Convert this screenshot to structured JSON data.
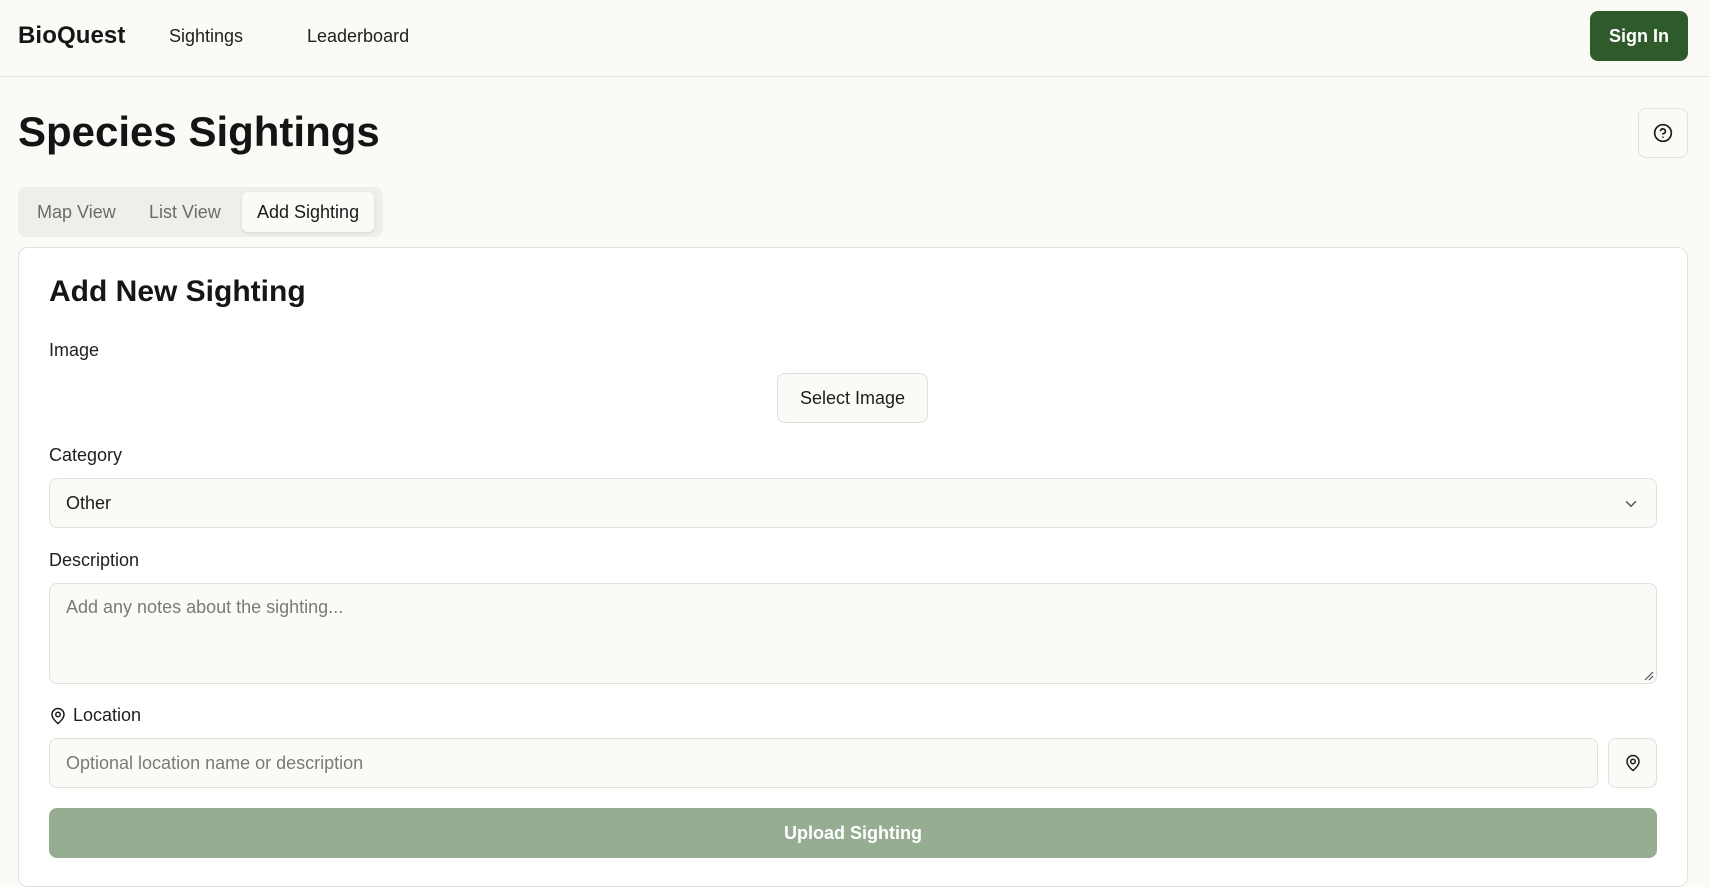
{
  "nav": {
    "brand": "BioQuest",
    "links": [
      "Sightings",
      "Leaderboard"
    ],
    "signin_label": "Sign In"
  },
  "page": {
    "title": "Species Sightings"
  },
  "tabs": {
    "items": [
      "Map View",
      "List View",
      "Add Sighting"
    ],
    "active": "Add Sighting"
  },
  "form": {
    "title": "Add New Sighting",
    "image_label": "Image",
    "select_image_label": "Select Image",
    "category_label": "Category",
    "category_value": "Other",
    "description_label": "Description",
    "description_placeholder": "Add any notes about the sighting...",
    "location_label": "Location",
    "location_placeholder": "Optional location name or description",
    "upload_label": "Upload Sighting"
  },
  "icons": {
    "help": "help-circle-icon",
    "chevron": "chevron-down-icon",
    "location_label_icon": "map-pin-icon",
    "locate_button_icon": "map-pin-icon"
  },
  "colors": {
    "brand_green": "#2e5a2c",
    "upload_disabled_green": "#96ad91",
    "background": "#fbfaf7"
  }
}
